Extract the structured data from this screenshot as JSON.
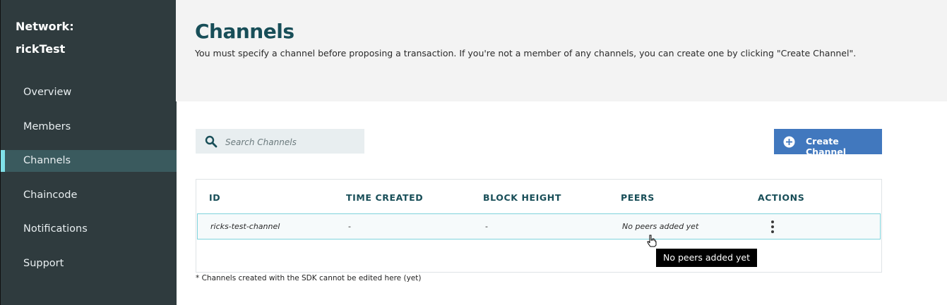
{
  "sidebar": {
    "network_label": "Network:",
    "network_name": "rickTest",
    "items": [
      {
        "label": "Overview"
      },
      {
        "label": "Members"
      },
      {
        "label": "Channels"
      },
      {
        "label": "Chaincode"
      },
      {
        "label": "Notifications"
      },
      {
        "label": "Support"
      }
    ],
    "active_item": "Channels",
    "accent_color": "#7fe0e8"
  },
  "header": {
    "title": "Channels",
    "description": "You must specify a channel before proposing a transaction. If you're not a member of any channels, you can create one by clicking \"Create Channel\"."
  },
  "search": {
    "placeholder": "Search Channels",
    "value": "",
    "icon": "search-icon"
  },
  "create_button": {
    "label": "Create Channel",
    "icon": "plus-circle-icon",
    "color": "#4178be"
  },
  "table": {
    "columns": [
      "ID",
      "TIME CREATED",
      "BLOCK HEIGHT",
      "PEERS",
      "ACTIONS"
    ],
    "rows": [
      {
        "id": "ricks-test-channel",
        "time_created": "-",
        "block_height": "-",
        "peers": "No peers added yet",
        "actions_icon": "kebab-menu-icon"
      }
    ]
  },
  "tooltip": {
    "text": "No peers added yet"
  },
  "footnote": "* Channels created with the SDK cannot be edited here (yet)",
  "colors": {
    "sidebar_bg": "#2f3b3e",
    "title_color": "#184e58",
    "header_bg": "#f3f3f3"
  }
}
